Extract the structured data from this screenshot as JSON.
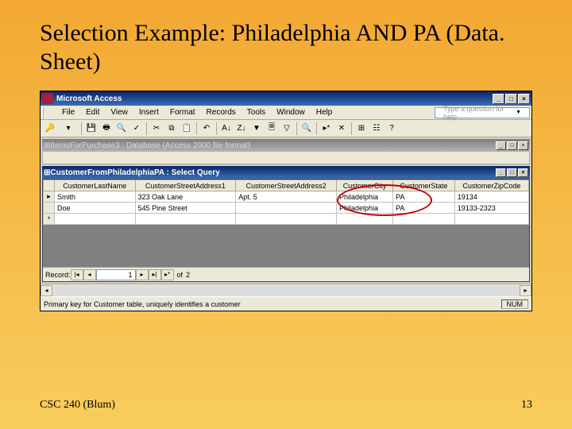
{
  "slide": {
    "title": "Selection Example: Philadelphia AND PA (Data. Sheet)",
    "footer_left": "CSC 240 (Blum)",
    "footer_right": "13"
  },
  "app": {
    "title": "Microsoft Access",
    "menu": [
      "File",
      "Edit",
      "View",
      "Insert",
      "Format",
      "Records",
      "Tools",
      "Window",
      "Help"
    ],
    "help_placeholder": "Type a question for help",
    "db_window_title": "ItemsForPurchase3 : Database (Access 2000 file format)",
    "query_window_title": "CustomerFromPhiladelphiaPA : Select Query",
    "columns": [
      "CustomerLastName",
      "CustomerStreetAddress1",
      "CustomerStreetAddress2",
      "CustomerCity",
      "CustomerState",
      "CustomerZipCode"
    ],
    "rows": [
      {
        "last": "Smith",
        "addr1": "323 Oak Lane",
        "addr2": "Apt. 5",
        "city": "Philadelphia",
        "state": "PA",
        "zip": "19134"
      },
      {
        "last": "Doe",
        "addr1": "545 Pine Street",
        "addr2": "",
        "city": "Philadelphia",
        "state": "PA",
        "zip": "19133-2323"
      }
    ],
    "record_nav": {
      "label": "Record:",
      "current": "1",
      "of_label": "of",
      "total": "2"
    },
    "statusbar": {
      "text": "Primary key for Customer table, uniquely identifies a customer",
      "mode": "NUM"
    }
  }
}
